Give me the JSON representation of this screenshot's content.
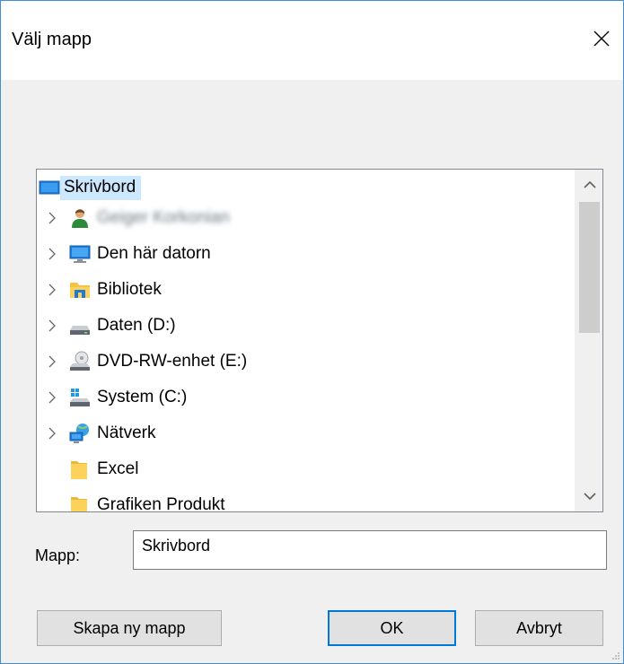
{
  "window": {
    "title": "Välj mapp"
  },
  "tree": {
    "items": [
      {
        "label": "Skrivbord",
        "icon": "desktop-icon",
        "selected": true,
        "expander": false
      },
      {
        "label": "Geiger Korkonian",
        "icon": "user-icon",
        "expander": true,
        "blurred": true
      },
      {
        "label": "Den här datorn",
        "icon": "computer-icon",
        "expander": true
      },
      {
        "label": "Bibliotek",
        "icon": "library-icon",
        "expander": true
      },
      {
        "label": "Daten (D:)",
        "icon": "drive-icon",
        "expander": true
      },
      {
        "label": "DVD-RW-enhet (E:)",
        "icon": "dvd-drive-icon",
        "expander": true
      },
      {
        "label": "System (C:)",
        "icon": "system-drive-icon",
        "expander": true
      },
      {
        "label": "Nätverk",
        "icon": "network-icon",
        "expander": true
      },
      {
        "label": "Excel",
        "icon": "folder-icon",
        "expander": false
      },
      {
        "label": "Grafiken Produkt",
        "icon": "folder-icon",
        "expander": false
      }
    ],
    "scroll_position": 0.0
  },
  "folder_field": {
    "label": "Mapp:",
    "value": "Skrivbord"
  },
  "buttons": {
    "new_folder": "Skapa ny mapp",
    "ok": "OK",
    "cancel": "Avbryt"
  },
  "colors": {
    "selection": "#cce8ff",
    "accent": "#0078d7",
    "window_border": "#3f8fd6"
  }
}
